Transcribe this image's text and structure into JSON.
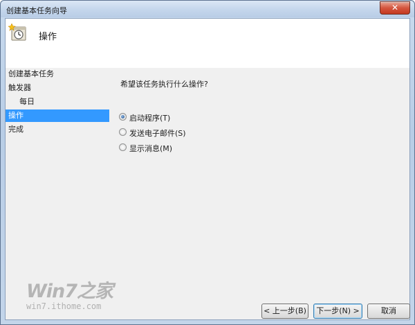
{
  "window": {
    "title": "创建基本任务向导",
    "close_label": "✕"
  },
  "header": {
    "icon": "scheduled-task-icon",
    "title": "操作"
  },
  "nav": {
    "items": [
      {
        "label": "创建基本任务",
        "selected": false,
        "indent": false
      },
      {
        "label": "触发器",
        "selected": false,
        "indent": false
      },
      {
        "label": "每日",
        "selected": false,
        "indent": true
      },
      {
        "label": "操作",
        "selected": true,
        "indent": false
      },
      {
        "label": "完成",
        "selected": false,
        "indent": false
      }
    ]
  },
  "main": {
    "question": "希望该任务执行什么操作?",
    "options": [
      {
        "label": "启动程序(T)",
        "checked": true
      },
      {
        "label": "发送电子邮件(S)",
        "checked": false
      },
      {
        "label": "显示消息(M)",
        "checked": false
      }
    ]
  },
  "watermark": {
    "logo": "Win7之家",
    "url": "win7.ithome.com"
  },
  "buttons": {
    "back": "< 上一步(B)",
    "next": "下一步(N) >",
    "cancel": "取消"
  },
  "colors": {
    "selection": "#3399ff",
    "panel": "#f0f0f0"
  }
}
